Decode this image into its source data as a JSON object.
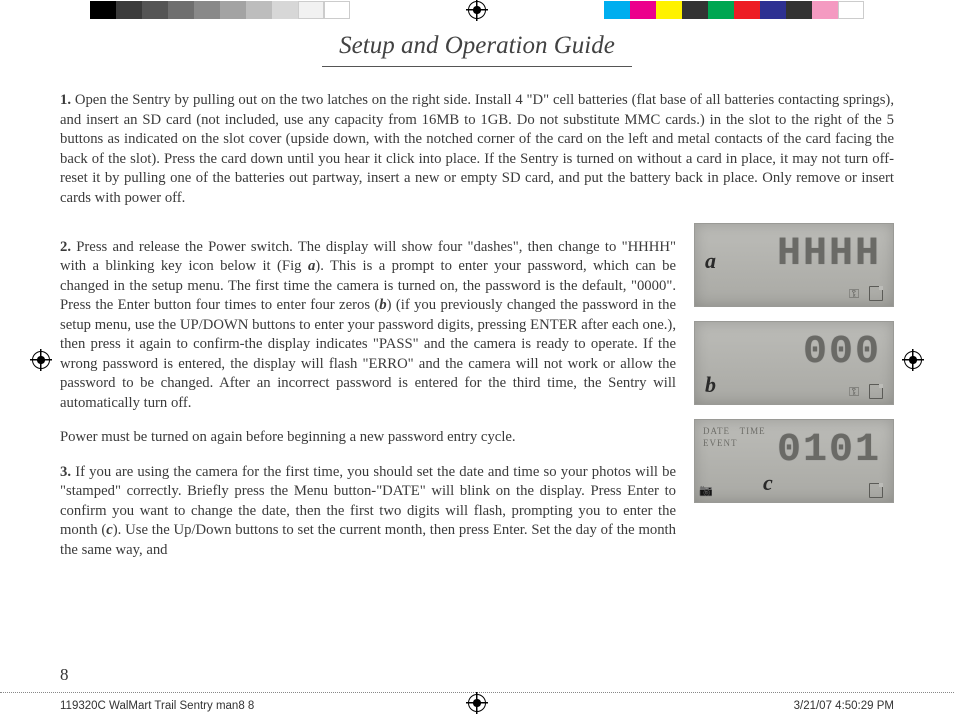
{
  "title": "Setup and Operation Guide",
  "step1": {
    "num": "1.",
    "text": "Open the Sentry by pulling out on the two latches on the right side. Install 4 \"D\" cell batteries (flat base of all batteries contacting springs), and insert an SD card (not included, use any capacity from 16MB to 1GB. Do not substitute MMC cards.) in the slot to the right of the 5 buttons as indicated on the slot cover (upside down, with the notched corner of the card on the left and metal contacts of the card facing the back of the slot). Press the card down until you hear it click into place. If the Sentry is turned on without a card in place, it may not turn off-reset it by pulling one of the batteries out partway, insert a new or empty SD card, and put the battery back in place. Only remove or insert cards with power off."
  },
  "step2": {
    "num": "2.",
    "text_a": "Press and release the Power switch. The display will show four \"dashes\", then change to \"HHHH\" with a blinking key icon below it (Fig ",
    "fig_a": "a",
    "text_b": "). This is a prompt to enter your password, which can be changed in the setup menu. The first time the camera is turned on, the password is the default, \"0000\".  Press the Enter button four times to enter four zeros (",
    "fig_b": "b",
    "text_c": ") (if you previously changed the password in the setup menu, use the UP/DOWN buttons to enter your password digits, pressing ENTER after each one.), then press it again to confirm-the display indicates \"PASS\" and the camera is ready to operate. If the wrong password is entered, the display will flash \"ERRO\" and the camera will not work or allow the password to be changed. After an incorrect password is entered for the third time, the Sentry will automatically turn off.",
    "text_d": "Power must be turned on again before beginning a new password entry cycle."
  },
  "step3": {
    "num": "3.",
    "text_a": "If you are using the camera for the first time, you should set the date and time so your photos will be \"stamped\" correctly. Briefly press the Menu button-\"DATE\" will blink on the display. Press Enter to confirm you want to change the date, then the first two digits will flash, prompting you to enter the month (",
    "fig_c": "c",
    "text_b": "). Use the Up/Down buttons to set the current month, then press Enter. Set the day of the month the same way, and"
  },
  "lcd_a": {
    "label": "a",
    "digits": "HHHH"
  },
  "lcd_b": {
    "label": "b",
    "digits": "000"
  },
  "lcd_c": {
    "label": "c",
    "digits": "0101",
    "tag_date": "DATE",
    "tag_time": "TIME",
    "tag_event": "EVENT"
  },
  "page_number": "8",
  "footer": {
    "filename": "119320C WalMart Trail Sentry man8   8",
    "timestamp": "3/21/07   4:50:29 PM"
  },
  "colorbar": {
    "left": [
      "#000000",
      "#3b3b3b",
      "#555555",
      "#6f6f6f",
      "#898989",
      "#a3a3a3",
      "#bdbdbd",
      "#d7d7d7",
      "#f1f1f1",
      "#ffffff"
    ],
    "right": [
      "#00aeef",
      "#ec008c",
      "#fff200",
      "#333333",
      "#00a651",
      "#ed1c24",
      "#2e3192",
      "#333333",
      "#f49ac1",
      "#ffffff"
    ]
  }
}
